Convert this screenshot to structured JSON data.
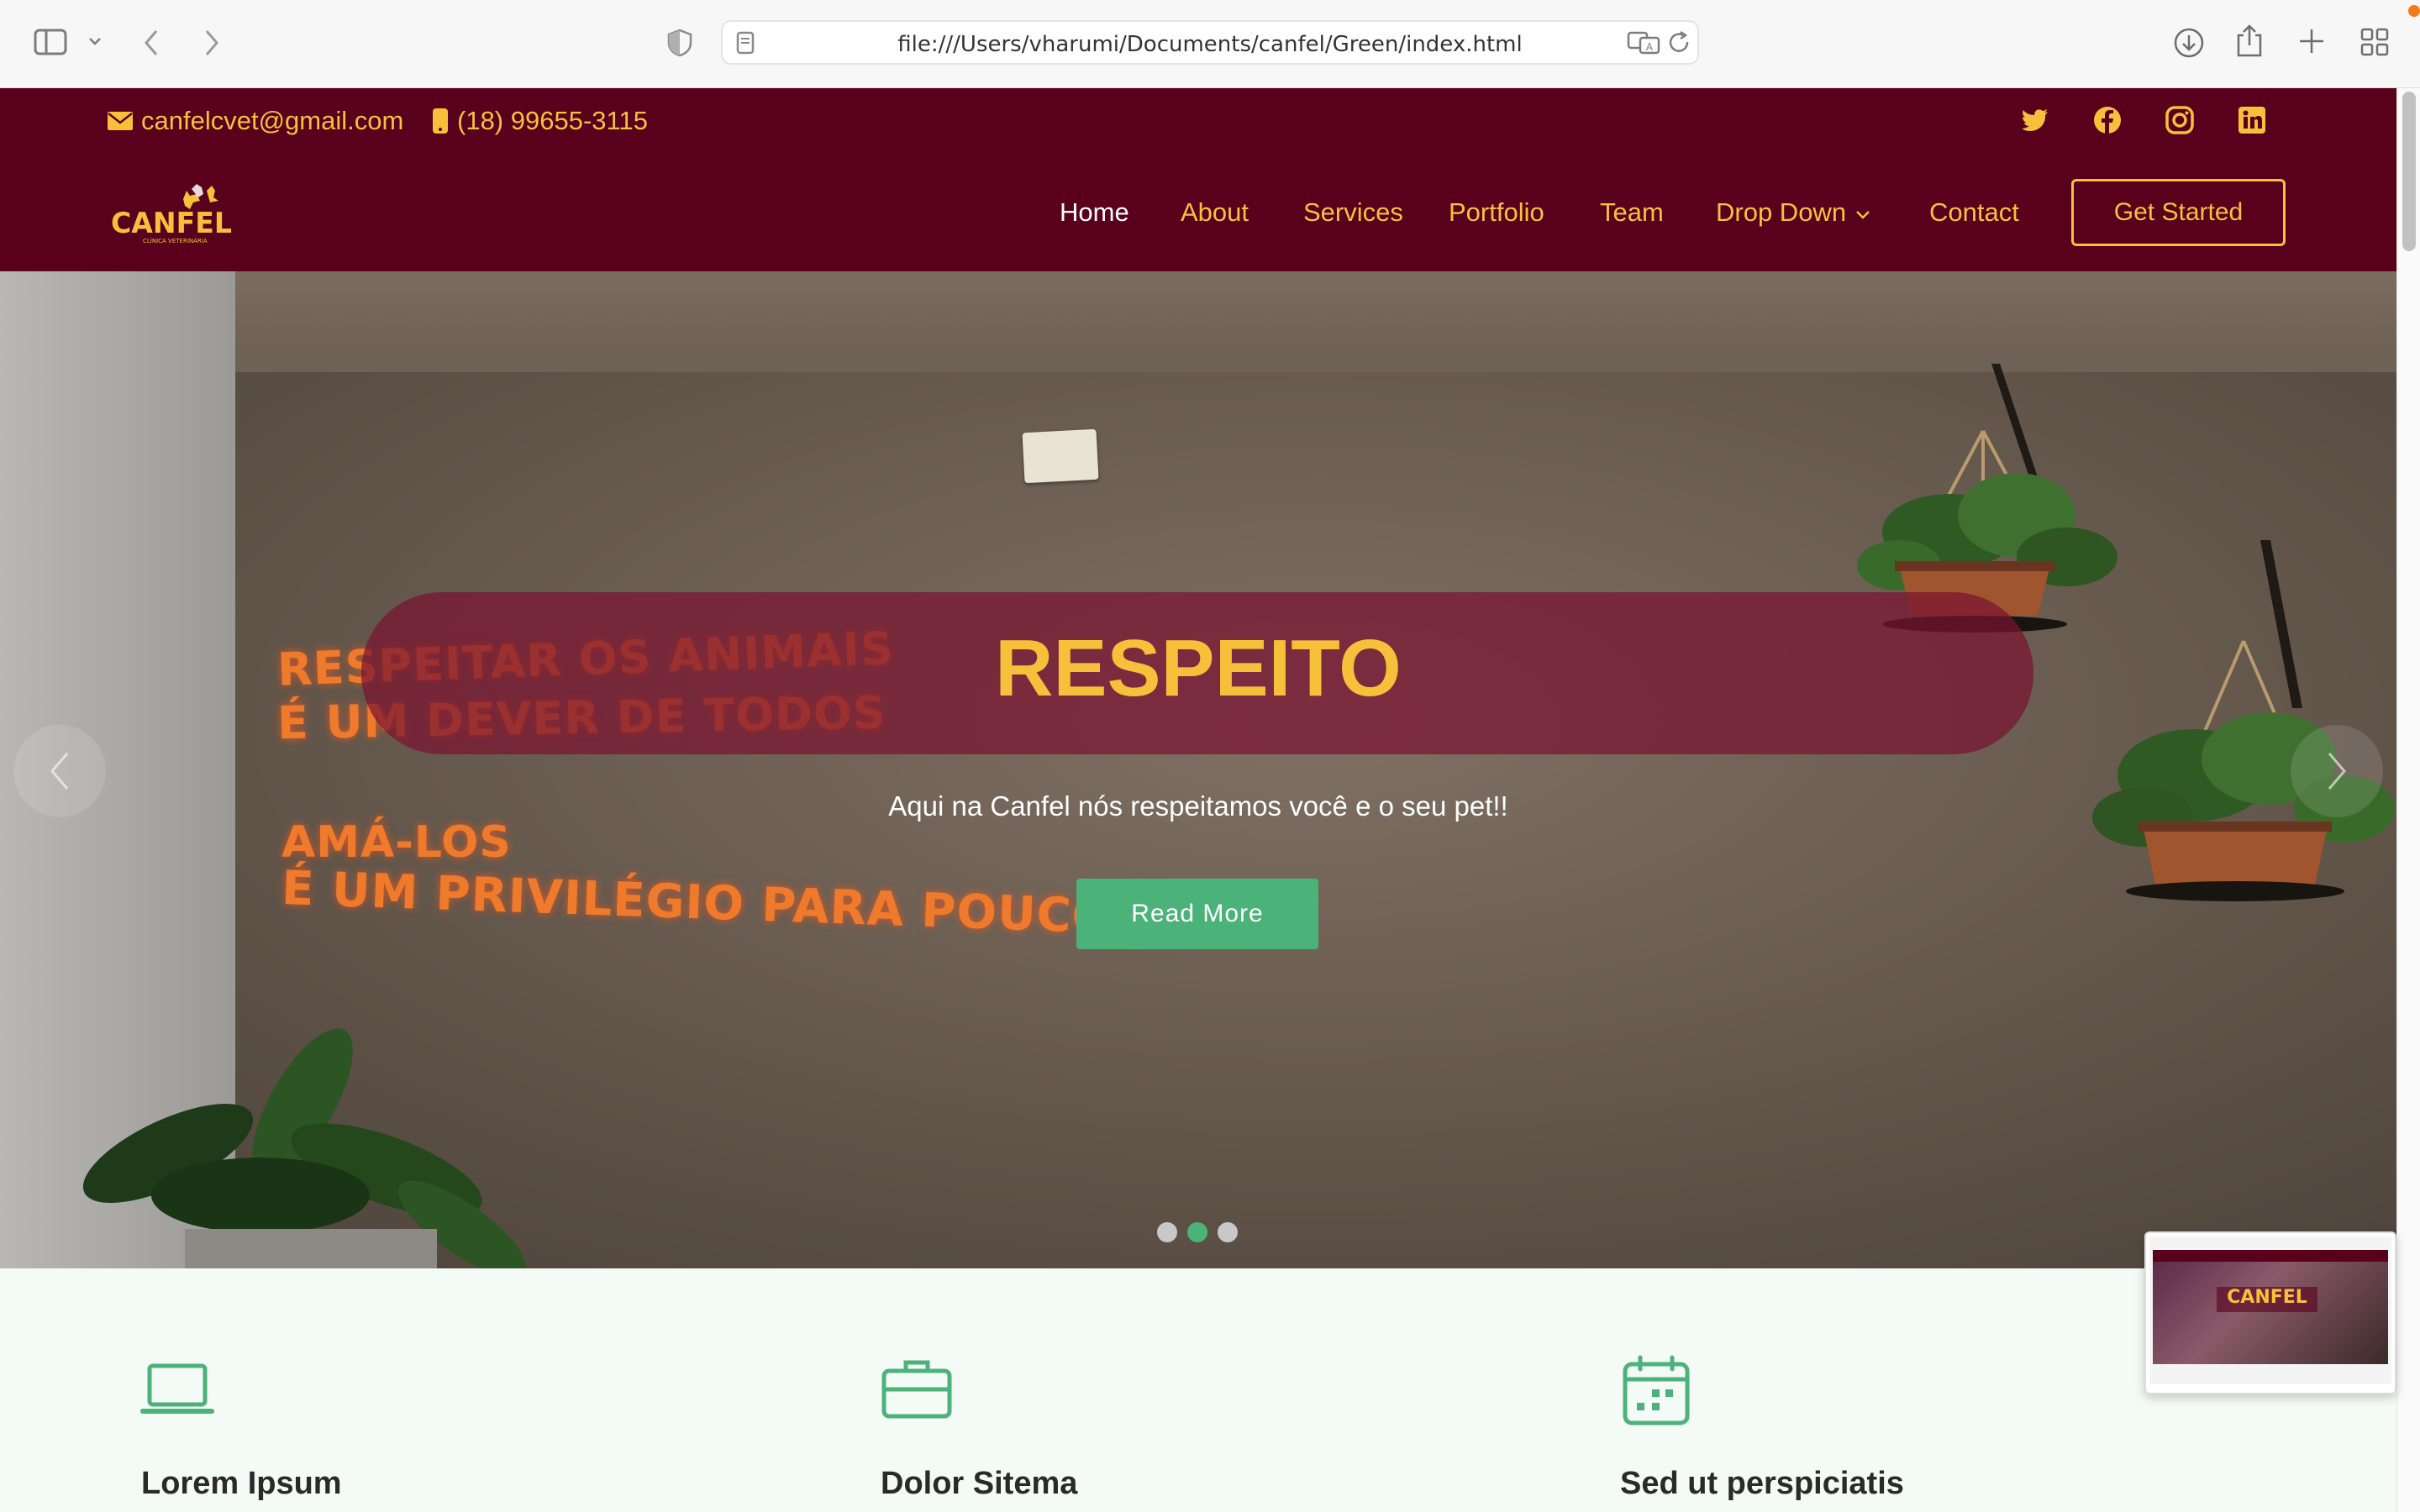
{
  "browser": {
    "url": "file:///Users/vharumi/Documents/canfel/Green/index.html"
  },
  "topbar": {
    "email": "canfelcvet@gmail.com",
    "phone": "(18) 99655-3115",
    "social_icons": [
      "twitter-icon",
      "facebook-icon",
      "instagram-icon",
      "linkedin-icon"
    ]
  },
  "header": {
    "logo_text": "CANFEL",
    "logo_subtext": "CLÍNICA VETERINÁRIA",
    "nav": [
      "Home",
      "About",
      "Services",
      "Portfolio",
      "Team",
      "Drop Down",
      "Contact"
    ],
    "active_nav": "Home",
    "cta": "Get Started"
  },
  "hero": {
    "title": "RESPEITO",
    "subtitle": "Aqui na Canfel nós respeitamos você e o seu pet!!",
    "button": "Read More",
    "wall_text_1": "RESPEITAR OS ANIMAIS",
    "wall_text_2": "É UM DEVER DE TODOS",
    "wall_text_3": "AMÁ-LOS",
    "wall_text_4": "É UM PRIVILÉGIO PARA POUCOS",
    "slides_total": 3,
    "active_slide": 2
  },
  "features": [
    {
      "title": "Lorem Ipsum",
      "icon": "laptop-icon"
    },
    {
      "title": "Dolor Sitema",
      "icon": "briefcase-icon"
    },
    {
      "title": "Sed ut perspiciatis",
      "icon": "calendar-icon"
    }
  ],
  "colors": {
    "primary": "#58001c",
    "accent": "#f7c03b",
    "green": "#4bb37a"
  }
}
